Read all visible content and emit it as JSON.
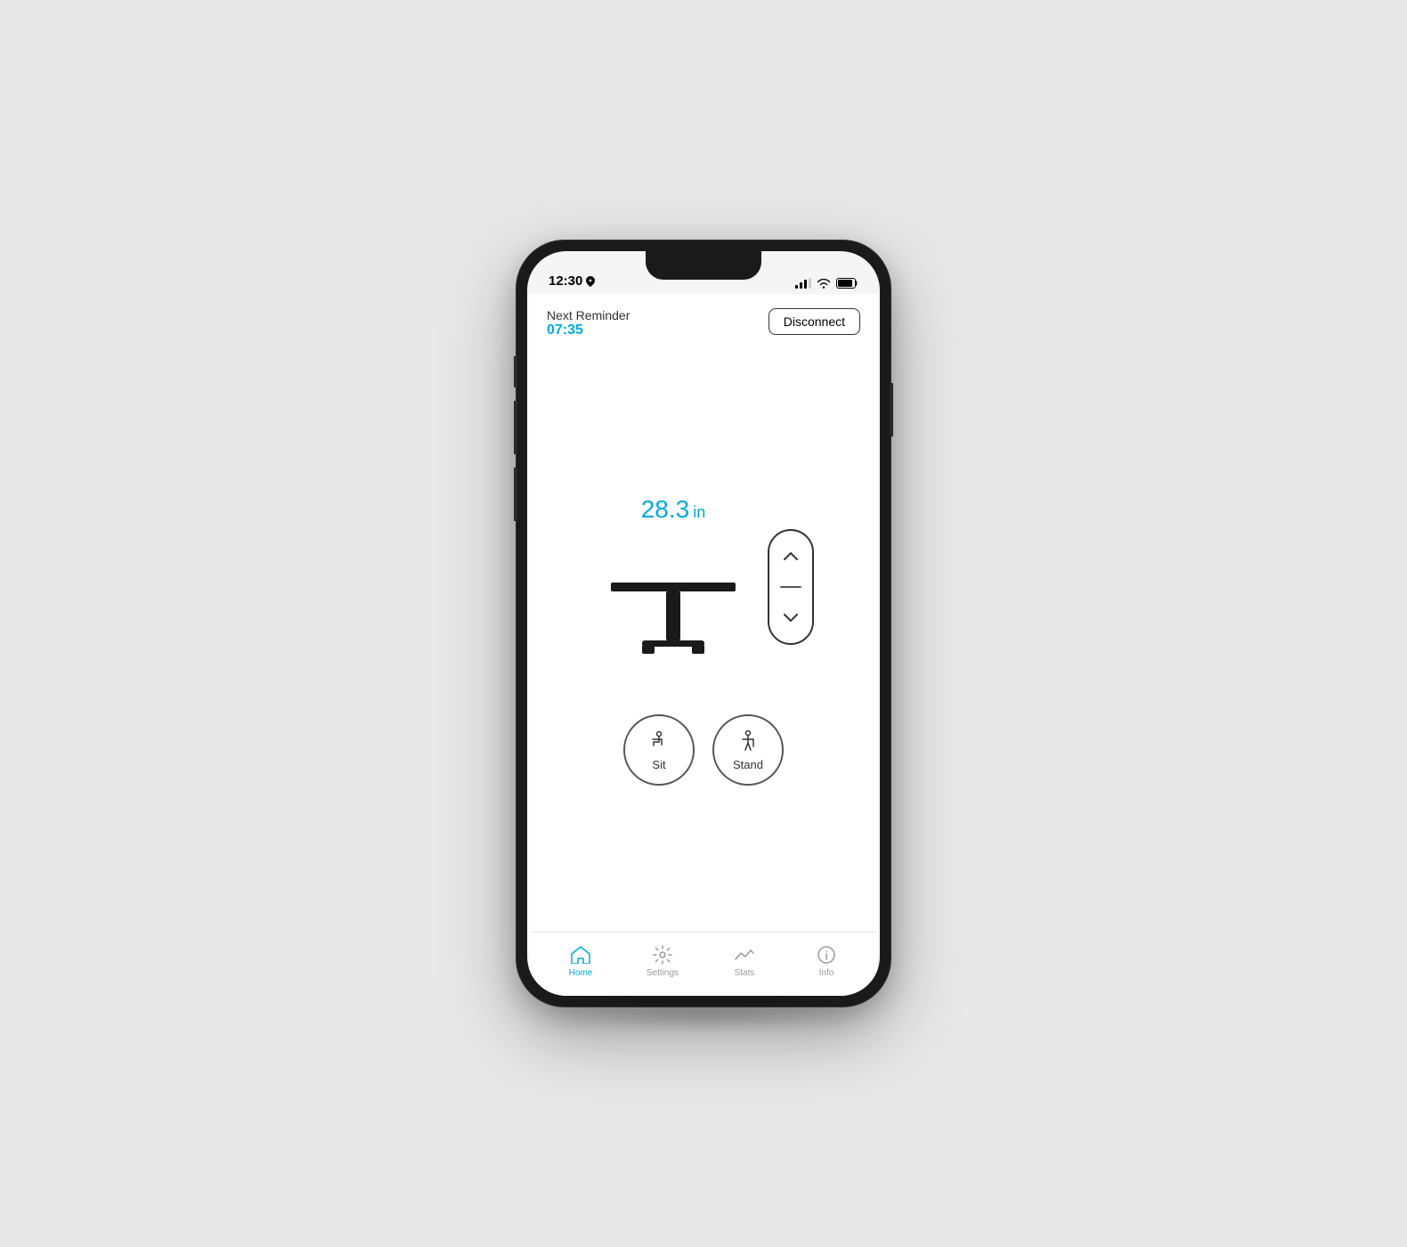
{
  "status_bar": {
    "time": "12:30",
    "location_icon": "location-arrow"
  },
  "header": {
    "reminder_label": "Next Reminder",
    "reminder_time": "07:35",
    "disconnect_label": "Disconnect"
  },
  "desk": {
    "height_value": "28.3",
    "height_unit": "in"
  },
  "presets": [
    {
      "label": "Sit",
      "icon": "sit-icon"
    },
    {
      "label": "Stand",
      "icon": "stand-icon"
    }
  ],
  "tabs": [
    {
      "label": "Home",
      "active": true,
      "icon": "home-icon"
    },
    {
      "label": "Settings",
      "active": false,
      "icon": "settings-icon"
    },
    {
      "label": "Stats",
      "active": false,
      "icon": "stats-icon"
    },
    {
      "label": "Info",
      "active": false,
      "icon": "info-icon"
    }
  ]
}
